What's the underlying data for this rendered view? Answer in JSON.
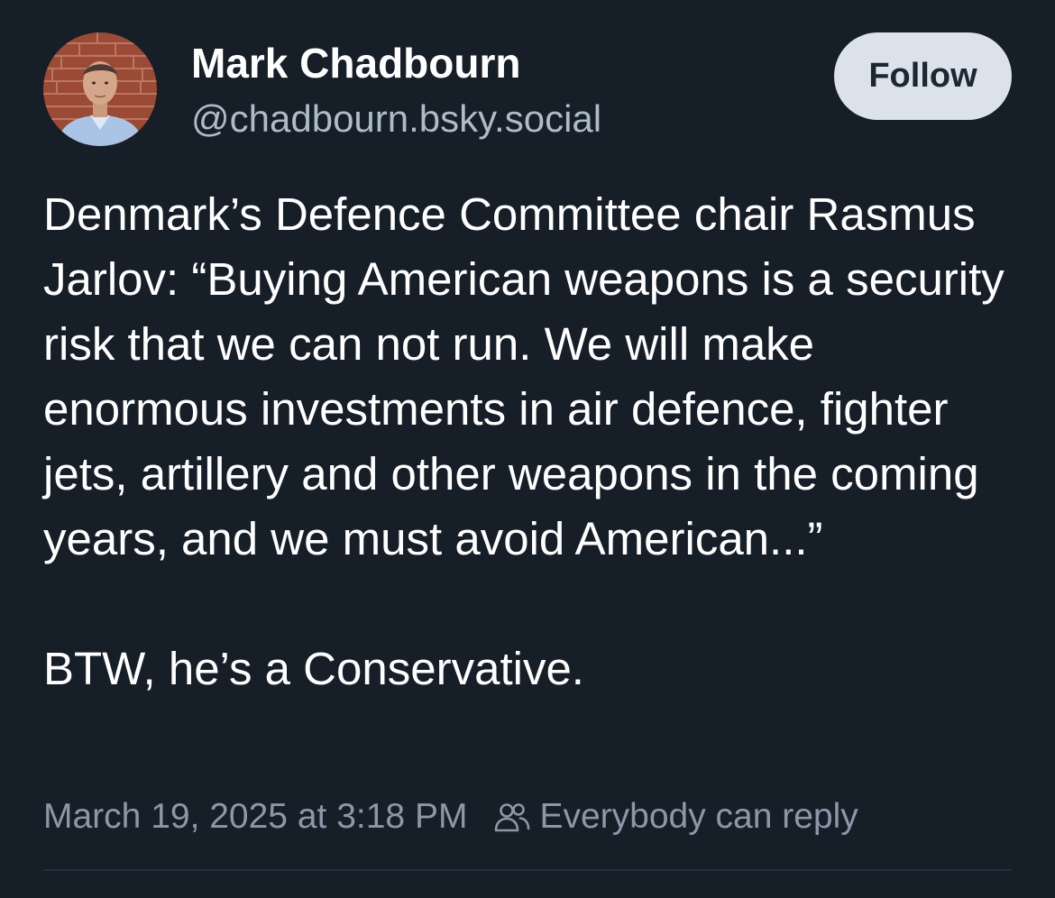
{
  "author": {
    "name": "Mark Chadbourn",
    "handle": "@chadbourn.bsky.social"
  },
  "follow_button": {
    "label": "Follow"
  },
  "post": {
    "paragraphs": [
      "Denmark’s Defence Committee chair Rasmus Jarlov: “Buying American weapons is a security risk that we can not run. We will make enormous investments in air defence, fighter jets, artillery and other weapons in the coming years, and we must avoid American...”",
      "BTW, he’s a Conservative."
    ]
  },
  "meta": {
    "timestamp": "March 19, 2025 at 3:18 PM",
    "reply_setting_icon": "people-icon",
    "reply_setting": "Everybody can reply"
  },
  "colors": {
    "background": "#161e27",
    "text_primary": "#ffffff",
    "text_secondary": "#aebbc9",
    "text_muted": "#8b98a8",
    "follow_button_bg": "#dce2ea",
    "follow_button_text": "#1d2733",
    "divider": "#26313d"
  }
}
